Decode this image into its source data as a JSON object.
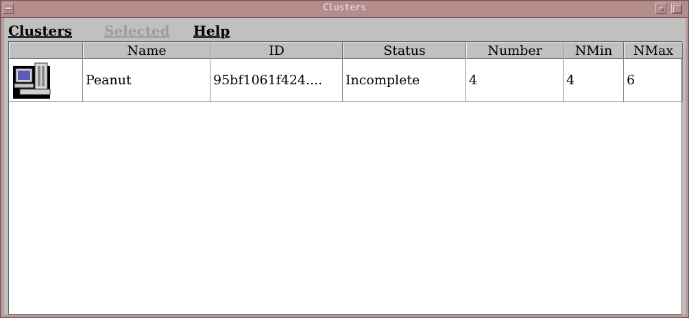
{
  "window": {
    "title": "Clusters"
  },
  "menubar": {
    "clusters_label": "Clusters",
    "selected_label": "Selected",
    "help_label": "Help"
  },
  "table": {
    "columns": [
      "",
      "Name",
      "ID",
      "Status",
      "Number",
      "NMin",
      "NMax"
    ],
    "rows": [
      {
        "icon": "cluster-computer-icon",
        "name": "Peanut",
        "id": "95bf1061f424....",
        "status": "Incomplete",
        "number": "4",
        "nmin": "4",
        "nmax": "6"
      }
    ]
  },
  "colors": {
    "titlebar": "#b48c8c",
    "window_frame": "#b89a9a",
    "background": "#c0c0c0",
    "disabled_text": "#9c9c9c"
  }
}
